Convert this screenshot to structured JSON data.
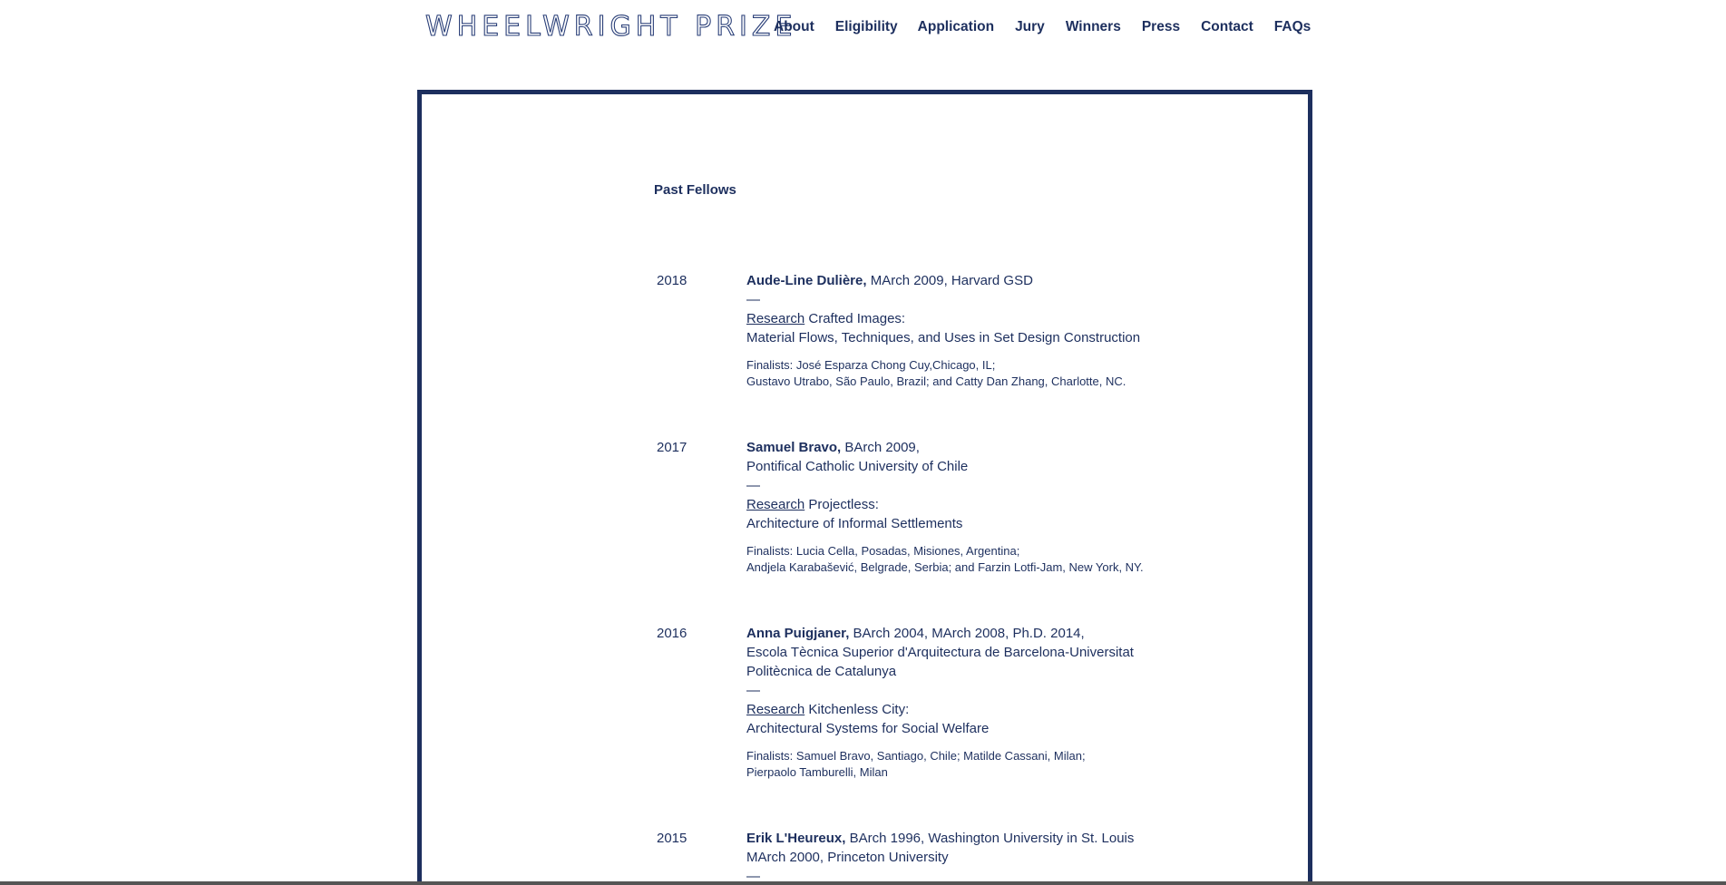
{
  "header": {
    "logo": "WHEELWRIGHT PRIZE",
    "nav": [
      "About",
      "Eligibility",
      "Application",
      "Jury",
      "Winners",
      "Press",
      "Contact",
      "FAQs"
    ]
  },
  "main": {
    "section_title": "Past Fellows",
    "fellows": [
      {
        "year": "2018",
        "name": "Aude-Line Dulière,",
        "credentials": [
          " MArch 2009, Harvard GSD"
        ],
        "dash": "—",
        "research_label": "Research",
        "research_lines": [
          " Crafted Images:",
          "Material Flows, Techniques, and Uses in Set Design Construction"
        ],
        "finalists": [
          "Finalists: José Esparza Chong Cuy,Chicago, IL;",
          "Gustavo Utrabo, São Paulo, Brazil; and Catty Dan Zhang, Charlotte, NC."
        ]
      },
      {
        "year": "2017",
        "name": "Samuel Bravo,",
        "credentials": [
          " BArch 2009,",
          "Pontifical Catholic University of Chile"
        ],
        "dash": "—",
        "research_label": "Research",
        "research_lines": [
          " Projectless:",
          "Architecture of Informal Settlements"
        ],
        "finalists": [
          "Finalists: Lucia Cella, Posadas, Misiones, Argentina;",
          "Andjela Karabašević, Belgrade, Serbia; and Farzin Lotfi-Jam, New York, NY."
        ]
      },
      {
        "year": "2016",
        "name": "Anna Puigjaner,",
        "credentials": [
          " BArch 2004, MArch 2008, Ph.D. 2014,",
          "Escola Tècnica Superior d'Arquitectura de Barcelona-Universitat",
          "Politècnica de Catalunya"
        ],
        "dash": "—",
        "research_label": "Research",
        "research_lines": [
          " Kitchenless City:",
          "Architectural Systems for Social Welfare"
        ],
        "finalists": [
          "Finalists: Samuel Bravo, Santiago, Chile; Matilde Cassani, Milan;",
          "Pierpaolo Tamburelli, Milan"
        ]
      },
      {
        "year": "2015",
        "name": "Erik L'Heureux,",
        "credentials": [
          " BArch 1996, Washington University in St. Louis",
          "MArch 2000, Princeton University"
        ],
        "dash": "—"
      }
    ]
  },
  "colors": {
    "navy": "#1d2f5e",
    "background": "#ffffff"
  }
}
